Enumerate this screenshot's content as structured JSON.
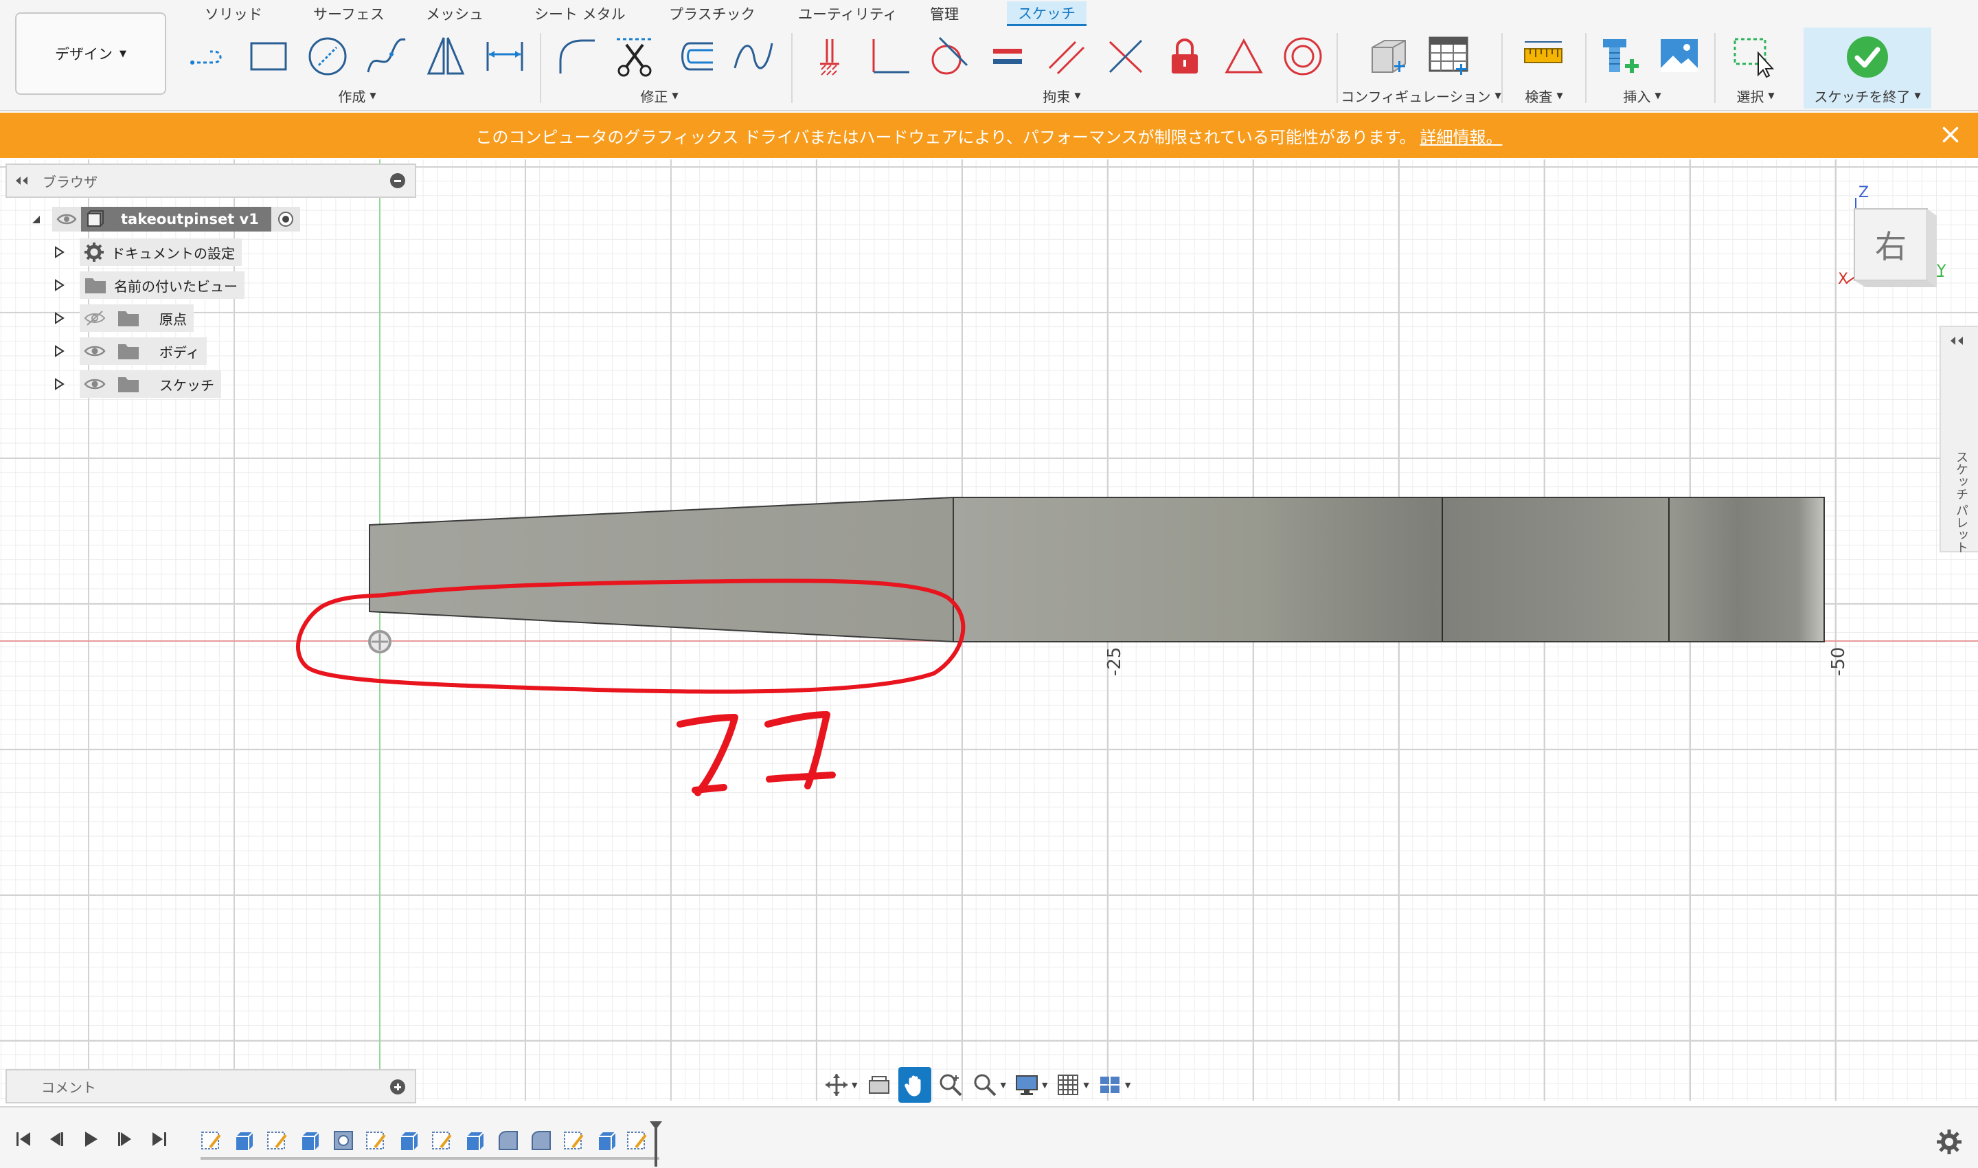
{
  "workspace": {
    "label": "デザイン"
  },
  "tabs": [
    {
      "label": "ソリッド",
      "active": false
    },
    {
      "label": "サーフェス",
      "active": false
    },
    {
      "label": "メッシュ",
      "active": false
    },
    {
      "label": "シート メタル",
      "active": false
    },
    {
      "label": "プラスチック",
      "active": false
    },
    {
      "label": "ユーティリティ",
      "active": false
    },
    {
      "label": "管理",
      "active": false
    },
    {
      "label": "スケッチ",
      "active": true
    }
  ],
  "ribbon": {
    "create": {
      "label": "作成",
      "tools": [
        "line-icon",
        "rectangle-icon",
        "circle-icon",
        "spline-icon",
        "triangle-icon",
        "dimension-icon"
      ]
    },
    "modify": {
      "label": "修正",
      "tools": [
        "fillet-icon",
        "trim-icon",
        "offset-icon",
        "curve-icon"
      ]
    },
    "constraints": {
      "label": "拘束",
      "tools": [
        "fix-icon",
        "perpendicular-icon",
        "tangent-icon",
        "equal-icon",
        "parallel-icon",
        "coincident-icon",
        "lock-icon",
        "triangle-constraint-icon",
        "concentric-icon"
      ]
    },
    "configuration": {
      "label": "コンフィギュレーション"
    },
    "inspect": {
      "label": "検査"
    },
    "insert": {
      "label": "挿入"
    },
    "select": {
      "label": "選択"
    },
    "finish": {
      "label": "スケッチを終了"
    }
  },
  "warning": {
    "message": "このコンピュータのグラフィックス ドライバまたはハードウェアにより、パフォーマンスが制限されている可能性があります。",
    "link": "詳細情報。"
  },
  "browser": {
    "title": "ブラウザ",
    "root": "takeoutpinset v1",
    "items": [
      {
        "label": "ドキュメントの設定",
        "icon": "gear-icon"
      },
      {
        "label": "名前の付いたビュー",
        "icon": "folder-icon"
      },
      {
        "label": "原点",
        "icon": "folder-icon",
        "visible": false
      },
      {
        "label": "ボディ",
        "icon": "folder-icon",
        "visible": true
      },
      {
        "label": "スケッチ",
        "icon": "folder-icon",
        "visible": true
      }
    ]
  },
  "viewcube": {
    "face": "右",
    "axes": {
      "z": "Z",
      "y": "Y",
      "x": "X"
    }
  },
  "palette": {
    "label": "スケッチ パレット"
  },
  "canvas": {
    "axis_labels": [
      "-25",
      "-50"
    ],
    "annotation": "11"
  },
  "comments": {
    "title": "コメント"
  },
  "colors": {
    "warning": "#f79c1c",
    "accent": "#1679c4",
    "finish_check": "#3cb34a",
    "annotation": "#e8141e",
    "constraint": "#d9343a"
  }
}
